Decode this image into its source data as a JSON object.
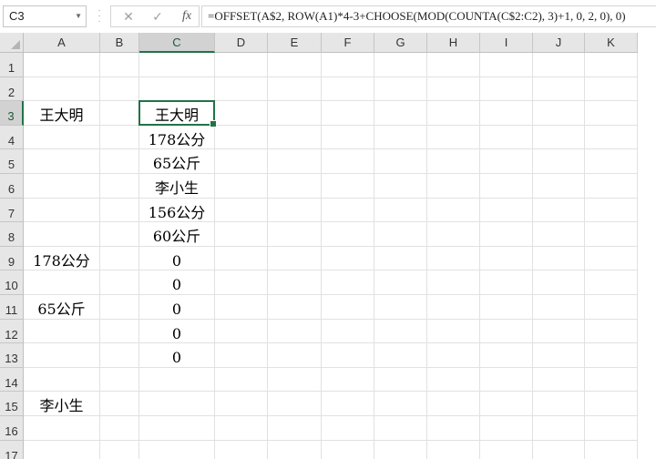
{
  "name_box": {
    "value": "C3",
    "dropdown_icon": "chevron-down-icon"
  },
  "formula_bar": {
    "cancel_glyph": "✕",
    "enter_glyph": "✓",
    "insert_function_label": "fx",
    "formula": "=OFFSET(A$2, ROW(A1)*4-3+CHOOSE(MOD(COUNTA(C$2:C2), 3)+1, 0, 2, 0), 0)"
  },
  "sheet": {
    "columns": [
      "A",
      "B",
      "C",
      "D",
      "E",
      "F",
      "G",
      "H",
      "I",
      "J",
      "K"
    ],
    "rows": [
      "1",
      "2",
      "3",
      "4",
      "5",
      "6",
      "7",
      "8",
      "9",
      "10",
      "11",
      "12",
      "13",
      "14",
      "15",
      "16",
      "17"
    ],
    "active_cell": "C3",
    "accent_color": "#217346",
    "column_A": {
      "3": "王大明",
      "9": "178公分",
      "11": "65公斤",
      "15": "李小生"
    },
    "column_C": {
      "3": "王大明",
      "4": "178公分",
      "5": "65公斤",
      "6": "李小生",
      "7": "156公分",
      "8": "60公斤",
      "9": "0",
      "10": "0",
      "11": "0",
      "12": "0",
      "13": "0"
    }
  }
}
